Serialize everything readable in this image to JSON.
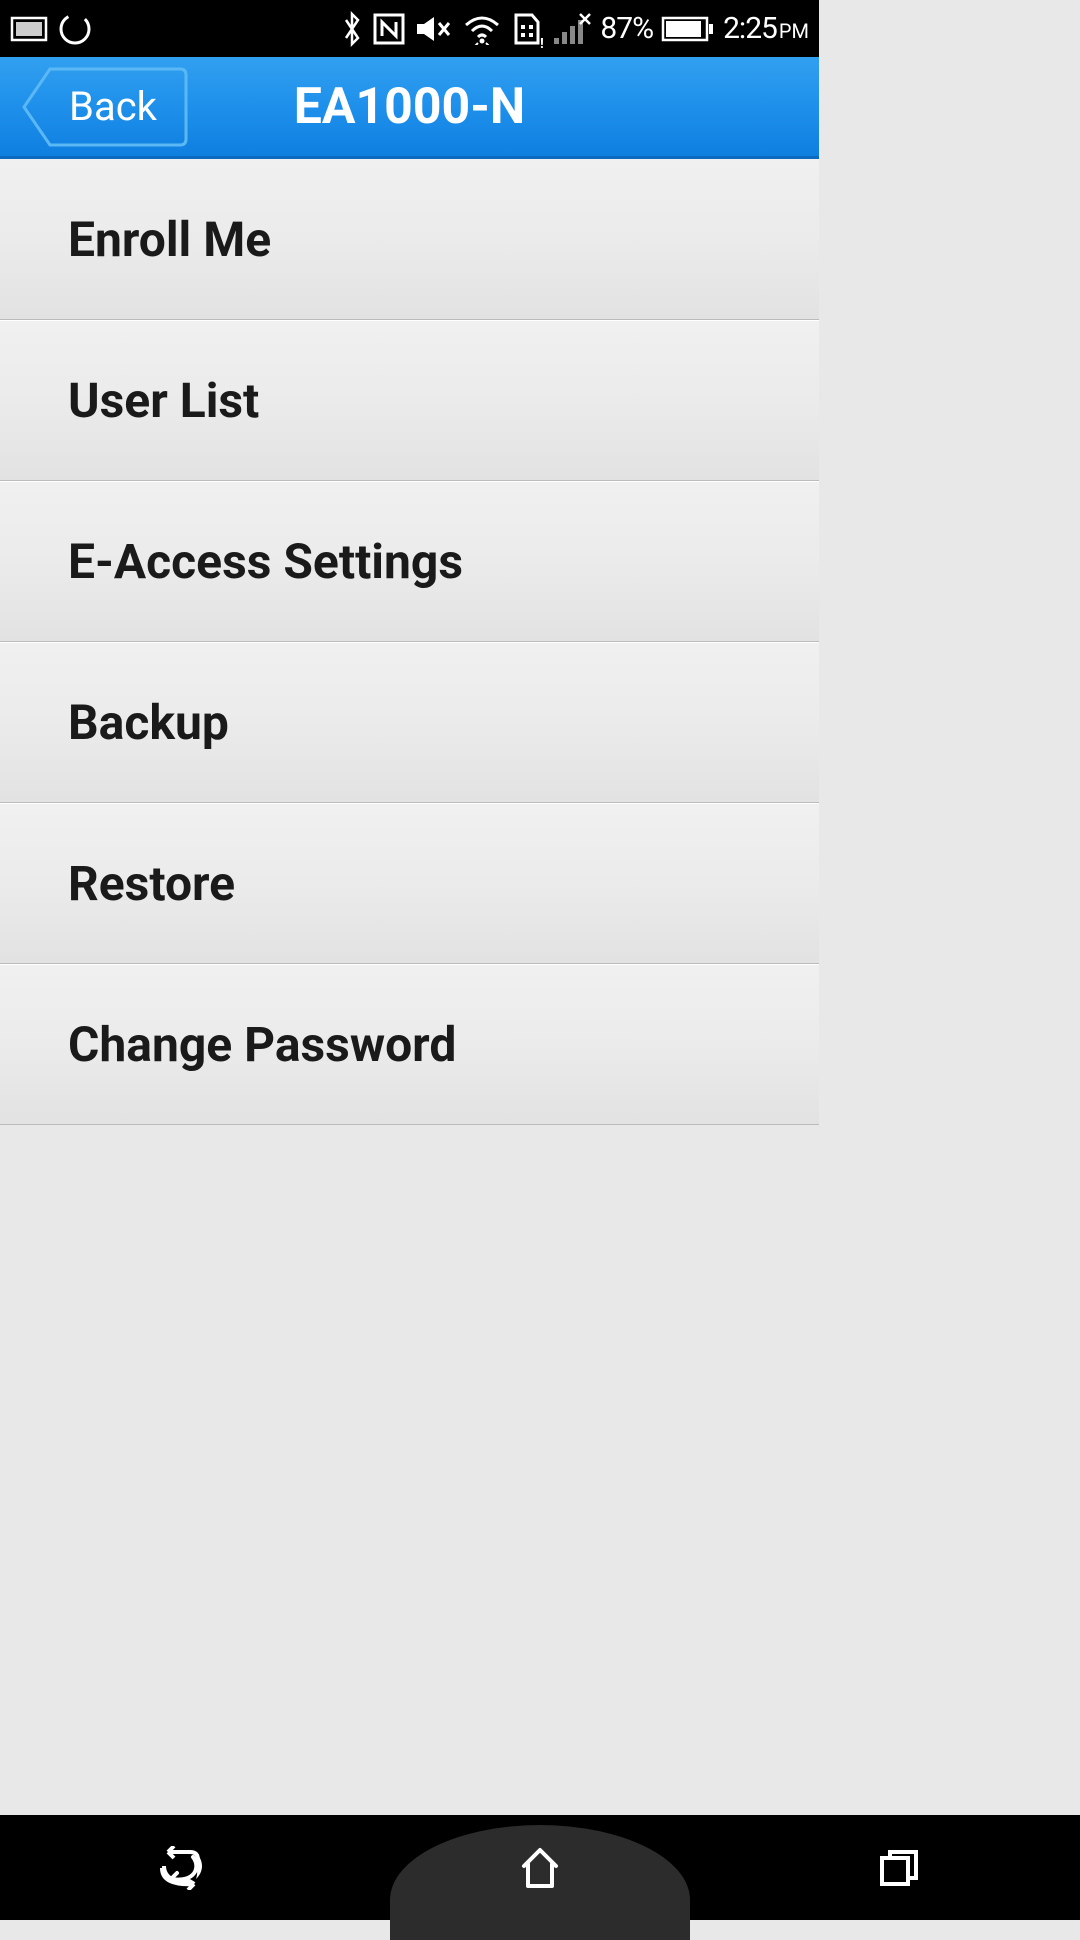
{
  "status_bar": {
    "battery_percent": "87%",
    "time": "2:25",
    "ampm": "PM"
  },
  "header": {
    "back_label": "Back",
    "title": "EA1000-N"
  },
  "menu": {
    "items": [
      {
        "label": "Enroll Me"
      },
      {
        "label": "User List"
      },
      {
        "label": "E-Access Settings"
      },
      {
        "label": "Backup"
      },
      {
        "label": "Restore"
      },
      {
        "label": "Change Password"
      }
    ]
  }
}
